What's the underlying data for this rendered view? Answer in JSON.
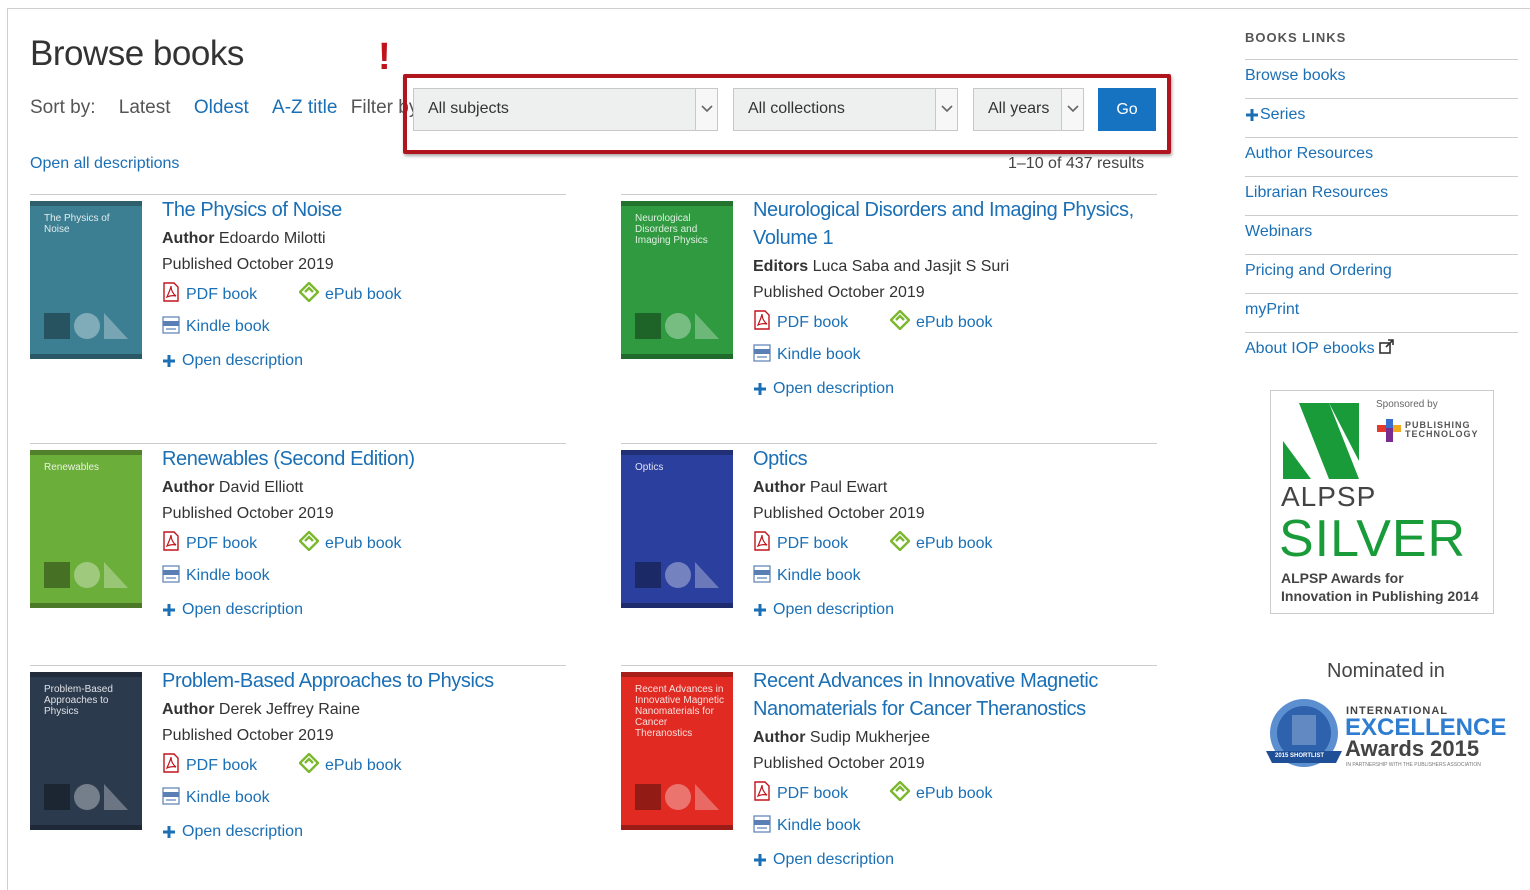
{
  "page": {
    "title": "Browse books",
    "alert_mark": "!",
    "sort_label": "Sort by:",
    "sort_options": [
      "Latest",
      "Oldest",
      "A-Z title"
    ],
    "filter_label": "Filter by",
    "filters": {
      "subjects": "All subjects",
      "collections": "All collections",
      "years": "All years",
      "go": "Go"
    },
    "open_all": "Open all descriptions",
    "results": "1–10 of 437 results"
  },
  "books": [
    {
      "title": "The Physics of Noise",
      "role": "Author",
      "people": "Edoardo Milotti",
      "published": "Published October 2019",
      "cover_color": "#3d7f92",
      "cover_text": "The Physics of Noise"
    },
    {
      "title": "Neurological Disorders and Imaging Physics, Volume 1",
      "role": "Editors",
      "people": "Luca Saba and Jasjit S Suri",
      "published": "Published October 2019",
      "cover_color": "#2f9a3f",
      "cover_text": "Neurological Disorders and Imaging Physics"
    },
    {
      "title": "Renewables (Second Edition)",
      "role": "Author",
      "people": "David Elliott",
      "published": "Published October 2019",
      "cover_color": "#6cae3a",
      "cover_text": "Renewables"
    },
    {
      "title": "Optics",
      "role": "Author",
      "people": "Paul Ewart",
      "published": "Published October 2019",
      "cover_color": "#2b3f9e",
      "cover_text": "Optics"
    },
    {
      "title": "Problem-Based Approaches to Physics",
      "role": "Author",
      "people": "Derek Jeffrey Raine",
      "published": "Published October 2019",
      "cover_color": "#2c3a4e",
      "cover_text": "Problem-Based Approaches to Physics"
    },
    {
      "title": "Recent Advances in Innovative Magnetic Nanomaterials for Cancer Theranostics",
      "role": "Author",
      "people": "Sudip Mukherjee",
      "published": "Published October 2019",
      "cover_color": "#e02a22",
      "cover_text": "Recent Advances in Innovative Magnetic Nanomaterials for Cancer Theranostics"
    }
  ],
  "formats": {
    "pdf": "PDF book",
    "epub": "ePub book",
    "kindle": "Kindle book",
    "open": "Open description"
  },
  "sidebar": {
    "heading": "BOOKS LINKS",
    "links": [
      "Browse books",
      "Series",
      "Author Resources",
      "Librarian Resources",
      "Webinars",
      "Pricing and Ordering",
      "myPrint",
      "About IOP ebooks"
    ]
  },
  "award": {
    "sponsored": "Sponsored by",
    "sponsor_line1": "PUBLISHING",
    "sponsor_line2": "TECHNOLOGY",
    "org": "ALPSP",
    "level": "SILVER",
    "line1": "ALPSP Awards for",
    "line2": "Innovation in Publishing 2014"
  },
  "nomination": {
    "label": "Nominated in",
    "badge_line1": "INTERNATIONAL",
    "badge_line2": "EXCELLENCE",
    "badge_line3": "Awards 2015",
    "badge_small": "IN PARTNERSHIP WITH THE PUBLISHERS ASSOCIATION",
    "badge_seal": "2015 SHORTLIST"
  },
  "colors": {
    "link": "#1a6fb5",
    "go_button": "#1673c2",
    "highlight_border": "#b0141c"
  }
}
